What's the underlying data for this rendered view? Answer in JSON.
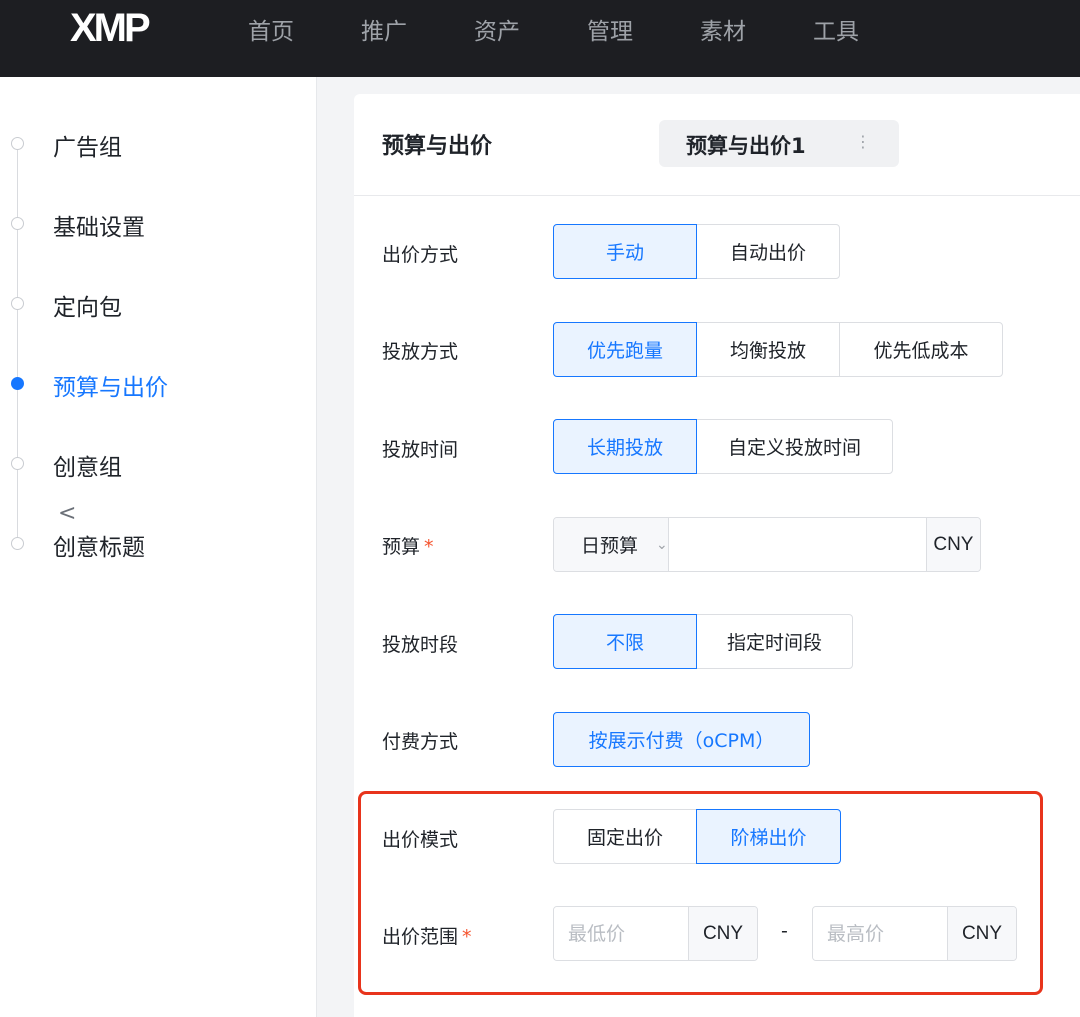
{
  "topbar": {
    "logo": "XMP",
    "nav": [
      "首页",
      "推广",
      "资产",
      "管理",
      "素材",
      "工具"
    ]
  },
  "sidebar": {
    "steps": [
      {
        "label": "广告组",
        "active": false
      },
      {
        "label": "基础设置",
        "active": false
      },
      {
        "label": "定向包",
        "active": false
      },
      {
        "label": "预算与出价",
        "active": true
      },
      {
        "label": "创意组",
        "active": false
      },
      {
        "label": "创意标题",
        "active": false
      }
    ],
    "collapse_icon": "chevron-left-icon"
  },
  "card": {
    "title": "预算与出价",
    "plan_tab": {
      "label": "预算与出价1",
      "more_icon": "more-vertical-icon"
    },
    "bid_method": {
      "label": "出价方式",
      "options": [
        "手动",
        "自动出价"
      ],
      "selected": "手动"
    },
    "delivery_method": {
      "label": "投放方式",
      "options": [
        "优先跑量",
        "均衡投放",
        "优先低成本"
      ],
      "selected": "优先跑量"
    },
    "delivery_time": {
      "label": "投放时间",
      "options": [
        "长期投放",
        "自定义投放时间"
      ],
      "selected": "长期投放"
    },
    "budget": {
      "label": "预算",
      "required_mark": "*",
      "type": "日预算",
      "value": "",
      "unit": "CNY"
    },
    "delivery_period": {
      "label": "投放时段",
      "options": [
        "不限",
        "指定时间段"
      ],
      "selected": "不限"
    },
    "payment_method": {
      "label": "付费方式",
      "options": [
        "按展示付费（oCPM）"
      ],
      "selected": "按展示付费（oCPM）"
    },
    "bid_mode": {
      "label": "出价模式",
      "options": [
        "固定出价",
        "阶梯出价"
      ],
      "selected": "阶梯出价"
    },
    "bid_range": {
      "label": "出价范围",
      "required_mark": "*",
      "min_placeholder": "最低价",
      "max_placeholder": "最高价",
      "unit": "CNY",
      "separator": "-"
    }
  },
  "colors": {
    "accent": "#1677ff",
    "highlight": "#e8341c",
    "topbar": "#1d1e22",
    "required": "#f5532d"
  }
}
